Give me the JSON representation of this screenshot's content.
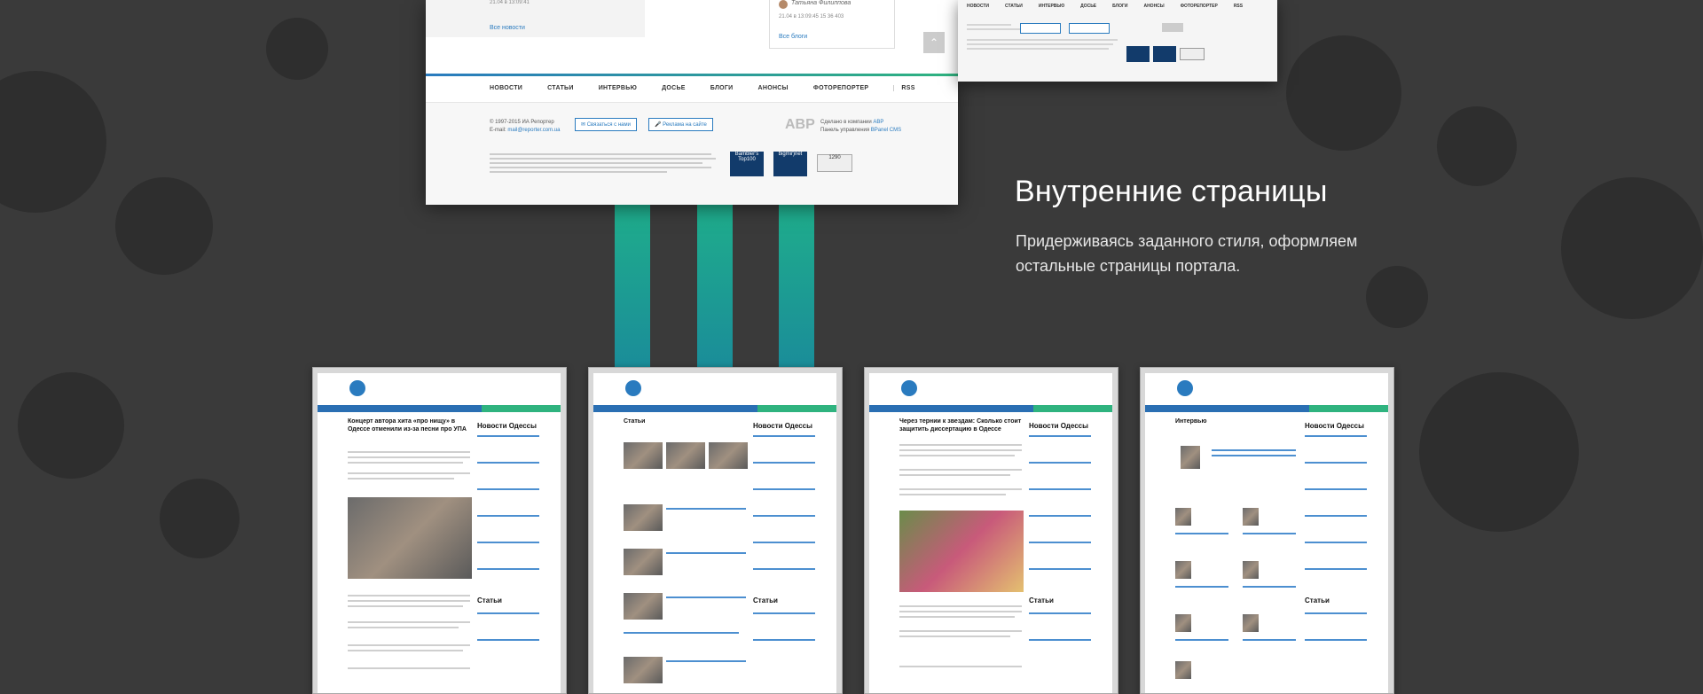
{
  "main_shot": {
    "news_meta": "21.04 в 13:09:41",
    "all_news": "Все новости",
    "blog_author": "Татьяна Филиппова",
    "blog_meta": "21.04 в 13:09:45  15  36  403",
    "all_blogs": "Все блоги",
    "nav": [
      "НОВОСТИ",
      "СТАТЬИ",
      "ИНТЕРВЬЮ",
      "ДОСЬЕ",
      "БЛОГИ",
      "АНОНСЫ",
      "ФОТОРЕПОРТЕР",
      "RSS"
    ],
    "copyright": "© 1997-2015 ИА Репортер",
    "email_label": "E-mail:",
    "email": "mail@reporter.com.ua",
    "contact_button": "Связаться с нами",
    "ads_button": "Реклама на сайте",
    "made_by_prefix": "Сделано в компании",
    "made_by_company": "ABP",
    "cms_prefix": "Панель управления",
    "cms_name": "BPanel CMS",
    "logo_text": "ABP",
    "badge1": "Bambler's Top100",
    "badge2": "bigmir)net",
    "badge3": "1290"
  },
  "right_shot": {
    "nav": [
      "НОВОСТИ",
      "СТАТЬИ",
      "ИНТЕРВЬЮ",
      "ДОСЬЕ",
      "БЛОГИ",
      "АНОНСЫ",
      "ФОТОРЕПОРТЕР",
      "RSS"
    ]
  },
  "heading": "Внутренние страницы",
  "subtext": "Придерживаясь заданного стиля, оформляем остальные страницы портала.",
  "thumbs": [
    {
      "title": "Концерт автора хита «про нищу» в Одессе отменили из-за песни про УПА",
      "side1": "Новости Одессы",
      "side2": "Статьи"
    },
    {
      "title": "Статьи",
      "side1": "Новости Одессы",
      "side2": "Статьи"
    },
    {
      "title": "Через тернии к звездам: Сколько стоит защитить диссертацию в Одессе",
      "side1": "Новости Одессы",
      "side2": "Статьи"
    },
    {
      "title": "Интервью",
      "side1": "Новости Одессы",
      "side2": "Статьи"
    }
  ]
}
